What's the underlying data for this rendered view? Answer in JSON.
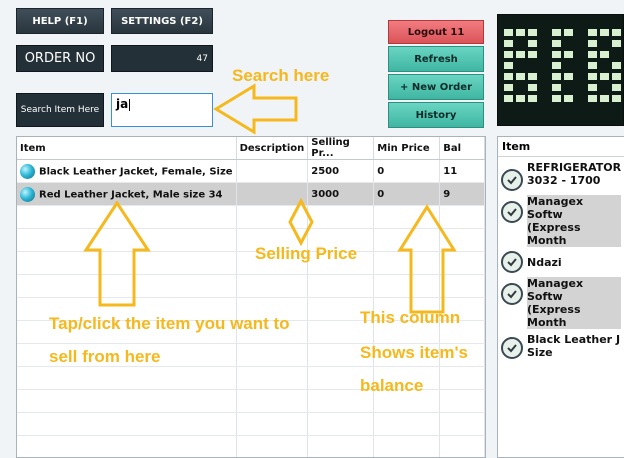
{
  "toolbar": {
    "help_label": "HELP (F1)",
    "settings_label": "SETTINGS (F2)",
    "order_no_label": "ORDER NO",
    "order_no_value": "47",
    "search_label": "Search Item Here",
    "search_value": "ja"
  },
  "right_buttons": {
    "logout_label": "Logout 11",
    "refresh_label": "Refresh",
    "new_order_label": "+ New Order",
    "history_label": "History"
  },
  "items_table": {
    "headers": [
      "Item",
      "Description",
      "Selling Pr...",
      "Min Price",
      "Bal"
    ],
    "rows": [
      {
        "item": "Black Leather Jacket, Female, Size",
        "description": "",
        "selling_price": "2500",
        "min_price": "0",
        "bal": "11"
      },
      {
        "item": "Red Leather Jacket, Male size 34",
        "description": "",
        "selling_price": "3000",
        "min_price": "0",
        "bal": "9"
      }
    ]
  },
  "order_list": {
    "header": "Item",
    "items": [
      {
        "line1": "REFRIGERATOR",
        "line2": "3032 - 1700"
      },
      {
        "line1": "Managex Softw",
        "line2": "(Express Month"
      },
      {
        "line1": "Ndazi",
        "line2": ""
      },
      {
        "line1": "Managex Softw",
        "line2": "(Express Month"
      },
      {
        "line1": "Black Leather J",
        "line2": "Size"
      }
    ]
  },
  "annotations": {
    "search_here": "Search here",
    "selling_price": "Selling Price",
    "tap_line1": "Tap/click the item you want to",
    "tap_line2": "sell from here",
    "col_line1": "This column",
    "col_line2": "Shows item's",
    "col_line3": "balance"
  },
  "colors": {
    "accent_teal": "#3fb6a2",
    "logout_red": "#da5459",
    "annotation_yellow": "#f5b81d",
    "selected_row": "#cfcfcf"
  }
}
